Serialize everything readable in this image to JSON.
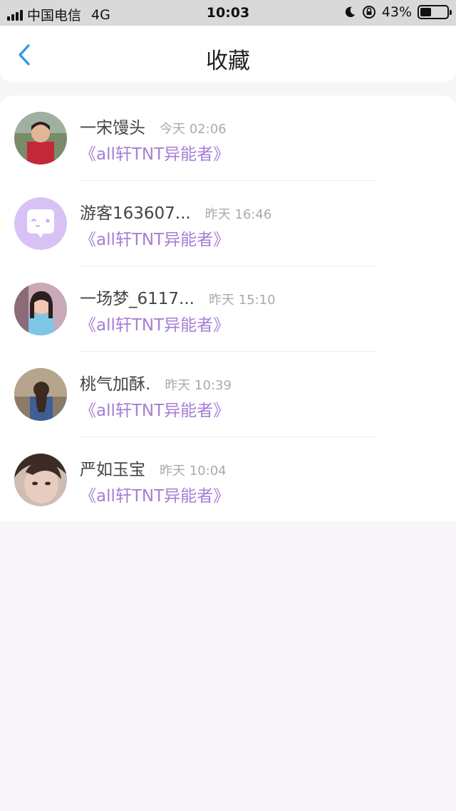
{
  "status_bar": {
    "carrier": "中国电信",
    "network": "4G",
    "time": "10:03",
    "battery_percent": "43%",
    "battery_level": 0.43
  },
  "nav": {
    "title": "收藏",
    "back_icon": "chevron-left-icon",
    "accent_color": "#2e9bea"
  },
  "colors": {
    "book_title": "#a77ed6",
    "timestamp": "#aaaaaa"
  },
  "items": [
    {
      "name": "一宋馒头",
      "time": "今天 02:06",
      "book": "《all轩TNT异能者》",
      "avatar": "photo-avatar"
    },
    {
      "name": "游客163607...",
      "time": "昨天 16:46",
      "book": "《all轩TNT异能者》",
      "avatar": "guest-chat-avatar-icon"
    },
    {
      "name": "一场梦_6117...",
      "time": "昨天 15:10",
      "book": "《all轩TNT异能者》",
      "avatar": "photo-avatar"
    },
    {
      "name": "桃气加酥.",
      "time": "昨天 10:39",
      "book": "《all轩TNT异能者》",
      "avatar": "photo-avatar"
    },
    {
      "name": "严如玉宝",
      "time": "昨天 10:04",
      "book": "《all轩TNT异能者》",
      "avatar": "photo-avatar"
    }
  ]
}
